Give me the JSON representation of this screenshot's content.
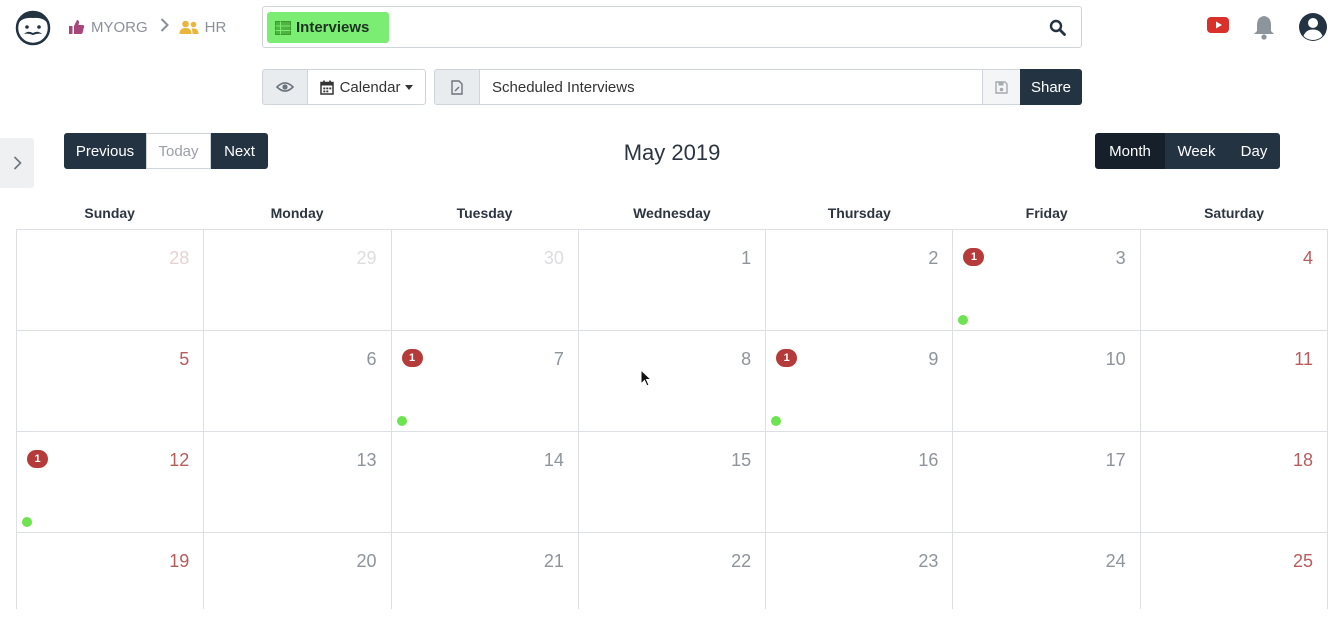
{
  "breadcrumb": {
    "org": "MYORG",
    "section": "HR"
  },
  "search": {
    "tag_label": "Interviews",
    "tag_color": "#7bed72"
  },
  "toolbar": {
    "view_label": "Calendar",
    "report_name": "Scheduled Interviews",
    "share_label": "Share"
  },
  "calendar_nav": {
    "previous_label": "Previous",
    "today_label": "Today",
    "next_label": "Next",
    "month_title": "May 2019",
    "views": {
      "month": "Month",
      "week": "Week",
      "day": "Day"
    },
    "active_view": "Month"
  },
  "weekdays": [
    "Sunday",
    "Monday",
    "Tuesday",
    "Wednesday",
    "Thursday",
    "Friday",
    "Saturday"
  ],
  "weeks": [
    [
      {
        "day": "28",
        "state": "other-weekend"
      },
      {
        "day": "29",
        "state": "other"
      },
      {
        "day": "30",
        "state": "other"
      },
      {
        "day": "1",
        "state": "current"
      },
      {
        "day": "2",
        "state": "current"
      },
      {
        "day": "3",
        "state": "current",
        "badge": "1",
        "event_dot": true
      },
      {
        "day": "4",
        "state": "weekend"
      }
    ],
    [
      {
        "day": "5",
        "state": "weekend"
      },
      {
        "day": "6",
        "state": "current"
      },
      {
        "day": "7",
        "state": "current",
        "badge": "1",
        "event_dot": true
      },
      {
        "day": "8",
        "state": "current"
      },
      {
        "day": "9",
        "state": "current",
        "badge": "1",
        "event_dot": true
      },
      {
        "day": "10",
        "state": "current"
      },
      {
        "day": "11",
        "state": "weekend"
      }
    ],
    [
      {
        "day": "12",
        "state": "weekend",
        "badge": "1",
        "event_dot": true
      },
      {
        "day": "13",
        "state": "current"
      },
      {
        "day": "14",
        "state": "current"
      },
      {
        "day": "15",
        "state": "current"
      },
      {
        "day": "16",
        "state": "current"
      },
      {
        "day": "17",
        "state": "current"
      },
      {
        "day": "18",
        "state": "weekend"
      }
    ],
    [
      {
        "day": "19",
        "state": "weekend"
      },
      {
        "day": "20",
        "state": "current"
      },
      {
        "day": "21",
        "state": "current"
      },
      {
        "day": "22",
        "state": "current"
      },
      {
        "day": "23",
        "state": "current"
      },
      {
        "day": "24",
        "state": "current"
      },
      {
        "day": "25",
        "state": "weekend"
      }
    ]
  ],
  "colors": {
    "primary_dark": "#243342",
    "badge_red": "#b53a3a",
    "event_green": "#6de44f",
    "weekend_red": "#b85c5c",
    "youtube_red": "#d9302a"
  },
  "icons": {
    "logo": "mustache-face-icon",
    "org": "thumbs-up-icon",
    "section": "users-icon",
    "search": "search-icon",
    "youtube": "youtube-icon",
    "notifications": "bell-icon",
    "account": "user-circle-icon",
    "view": "eye-icon",
    "calendar": "calendar-icon",
    "report": "document-icon",
    "save": "save-icon",
    "sidebar": "chevron-right-icon"
  }
}
